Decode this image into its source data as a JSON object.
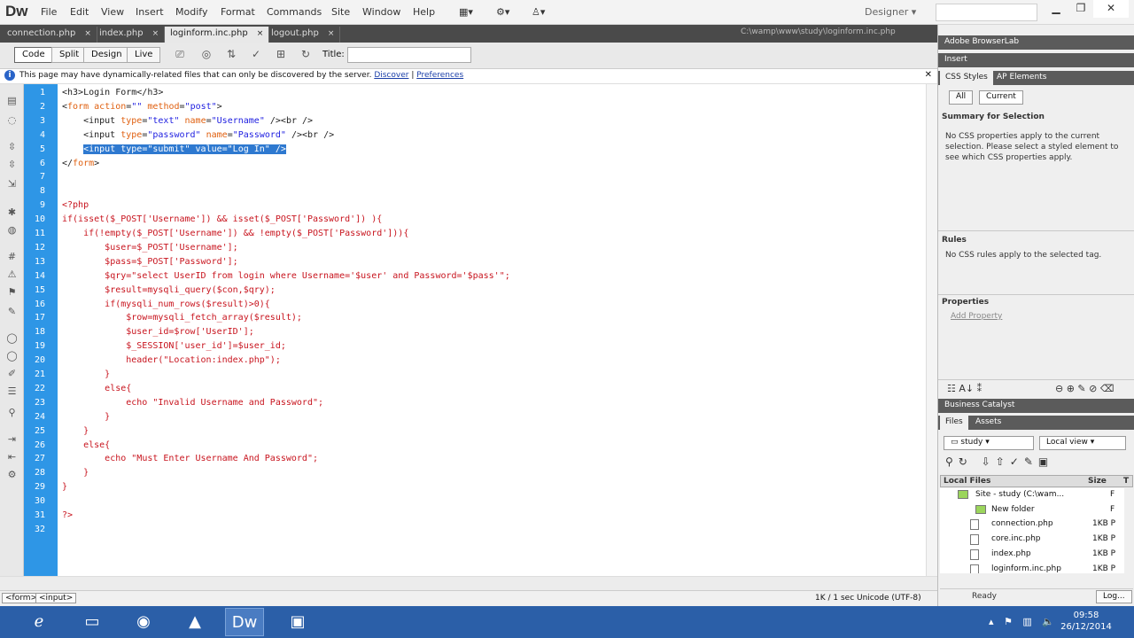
{
  "app": {
    "logo": "Dw",
    "workspace": "Designer"
  },
  "menu": [
    "File",
    "Edit",
    "View",
    "Insert",
    "Modify",
    "Format",
    "Commands",
    "Site",
    "Window",
    "Help"
  ],
  "tabs": [
    {
      "label": "connection.php"
    },
    {
      "label": "index.php"
    },
    {
      "label": "loginform.inc.php"
    },
    {
      "label": "logout.php"
    }
  ],
  "doc_path": "C:\\wamp\\www\\study\\loginform.inc.php",
  "toolbar": {
    "code": "Code",
    "split": "Split",
    "design": "Design",
    "live": "Live",
    "title_label": "Title:"
  },
  "infobar": {
    "text": "This page may have dynamically-related files that can only be discovered by the server.",
    "discover": "Discover",
    "preferences": "Preferences"
  },
  "code_lines": [
    "<h3>Login Form</h3>",
    "<form action=\"\" method=\"post\">",
    "    <input type=\"text\" name=\"Username\" /><br />",
    "    <input type=\"password\" name=\"Password\" /><br />",
    "    <input type=\"submit\" value=\"Log In\" />",
    "</form>",
    "",
    "",
    "<?php",
    "if(isset($_POST['Username']) && isset($_POST['Password']) ){",
    "    if(!empty($_POST['Username']) && !empty($_POST['Password'])){",
    "        $user=$_POST['Username'];",
    "        $pass=$_POST['Password'];",
    "        $qry=\"select UserID from login where Username='$user' and Password='$pass'\";",
    "        $result=mysqli_query($con,$qry);",
    "        if(mysqli_num_rows($result)>0){",
    "            $row=mysqli_fetch_array($result);",
    "            $user_id=$row['UserID'];",
    "            $_SESSION['user_id']=$user_id;",
    "            header(\"Location:index.php\");",
    "        }",
    "        else{",
    "            echo \"Invalid Username and Password\";",
    "        }",
    "    }",
    "    else{",
    "        echo \"Must Enter Username And Password\";",
    "    }",
    "}",
    "",
    "?>",
    ""
  ],
  "status": {
    "crumbs": [
      "<form>",
      "<input>"
    ],
    "info": "1K / 1 sec  Unicode (UTF-8)"
  },
  "panel": {
    "browserlab": "Adobe BrowserLab",
    "insert": "Insert",
    "css_tab": "CSS Styles",
    "ap_tab": "AP Elements",
    "all_btn": "All",
    "current_btn": "Current",
    "summary_title": "Summary for Selection",
    "summary_text": "No CSS properties apply to the current selection.  Please select a styled element to see which CSS properties apply.",
    "rules_title": "Rules",
    "rules_text": "No CSS rules apply to the selected tag.",
    "properties_title": "Properties",
    "add_property": "Add Property",
    "business_catalyst": "Business Catalyst",
    "files_tab": "Files",
    "assets_tab": "Assets",
    "site_select": "study",
    "view_select": "Local view",
    "local_files": "Local Files",
    "size_col": "Size",
    "type_col": "T",
    "files": [
      {
        "name": "Site - study (C:\\wam...",
        "size": "",
        "type": "F"
      },
      {
        "name": "New folder",
        "size": "",
        "type": "F"
      },
      {
        "name": "connection.php",
        "size": "1KB",
        "type": "P"
      },
      {
        "name": "core.inc.php",
        "size": "1KB",
        "type": "P"
      },
      {
        "name": "index.php",
        "size": "1KB",
        "type": "P"
      },
      {
        "name": "loginform.inc.php",
        "size": "1KB",
        "type": "P"
      }
    ],
    "ready": "Ready",
    "log_btn": "Log..."
  },
  "clock": {
    "time": "09:58",
    "date": "26/12/2014"
  }
}
